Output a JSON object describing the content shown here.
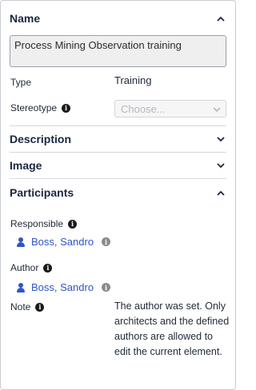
{
  "sections": {
    "name": {
      "title": "Name",
      "expanded": true
    },
    "description": {
      "title": "Description",
      "expanded": false
    },
    "image": {
      "title": "Image",
      "expanded": false
    },
    "participants": {
      "title": "Participants",
      "expanded": true
    }
  },
  "name_field": {
    "value": "Process Mining Observation training"
  },
  "type": {
    "label": "Type",
    "value": "Training"
  },
  "stereotype": {
    "label": "Stereotype",
    "placeholder": "Choose..."
  },
  "responsible": {
    "label": "Responsible",
    "user": "Boss, Sandro"
  },
  "author": {
    "label": "Author",
    "user": "Boss, Sandro"
  },
  "note": {
    "label": "Note",
    "text": "The author was set. Only architects and the defined authors are allowed to edit the current element."
  },
  "icons": {
    "info": "info-icon",
    "user": "user-icon",
    "chevron_up": "chevron-up-icon",
    "chevron_down": "chevron-down-icon"
  },
  "colors": {
    "link": "#2f55c9",
    "heading": "#1a2740",
    "divider": "#d6d8dc"
  }
}
